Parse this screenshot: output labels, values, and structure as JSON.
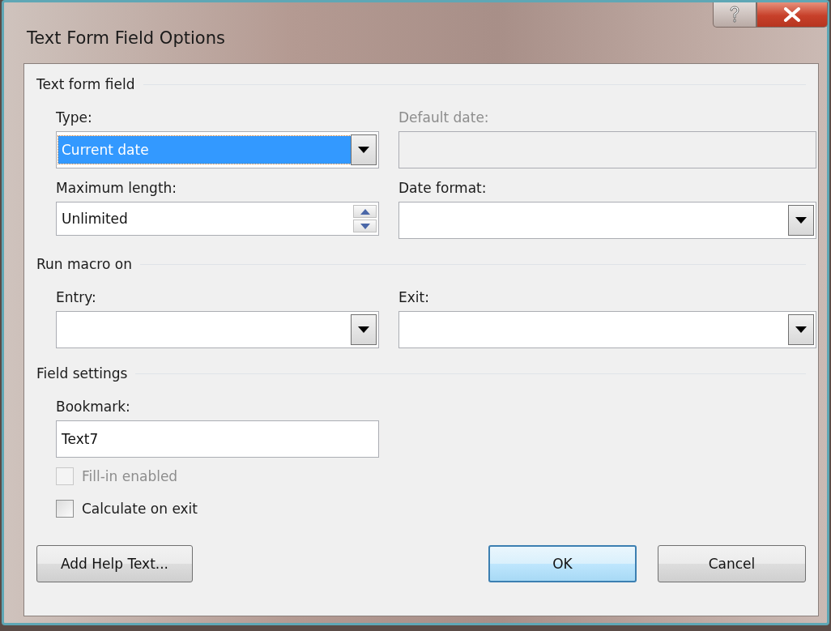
{
  "window": {
    "title": "Text Form Field Options"
  },
  "sections": [
    {
      "title": "Text form field",
      "fields": [
        {
          "kind": "dropdown",
          "label": "Type:",
          "value": "Current date",
          "highlighted": true,
          "disabled": false
        },
        {
          "kind": "text",
          "label": "Default date:",
          "disabled": true
        },
        {
          "kind": "spinner",
          "label": "Maximum length:",
          "value": "Unlimited",
          "disabled": false
        },
        {
          "kind": "dropdown",
          "label": "Date format:",
          "highlighted": false,
          "disabled": false
        }
      ]
    },
    {
      "title": "Run macro on",
      "fields": [
        {
          "kind": "dropdown",
          "label": "Entry:",
          "highlighted": false,
          "disabled": false
        },
        {
          "kind": "dropdown",
          "label": "Exit:",
          "highlighted": false,
          "disabled": false
        }
      ]
    },
    {
      "title": "Field settings",
      "fields": [
        {
          "kind": "text",
          "label": "Bookmark:",
          "value": "Text7",
          "disabled": false
        }
      ],
      "checkboxes": [
        {
          "label": "Fill-in enabled",
          "checked": false,
          "disabled": true
        },
        {
          "label": "Calculate on exit",
          "checked": false,
          "disabled": false
        }
      ]
    }
  ],
  "buttons": [
    {
      "label": "Add Help Text...",
      "default": false,
      "kind": "left"
    },
    {
      "label": "OK",
      "default": true,
      "kind": "right"
    },
    {
      "label": "Cancel",
      "default": false,
      "kind": "right"
    }
  ]
}
